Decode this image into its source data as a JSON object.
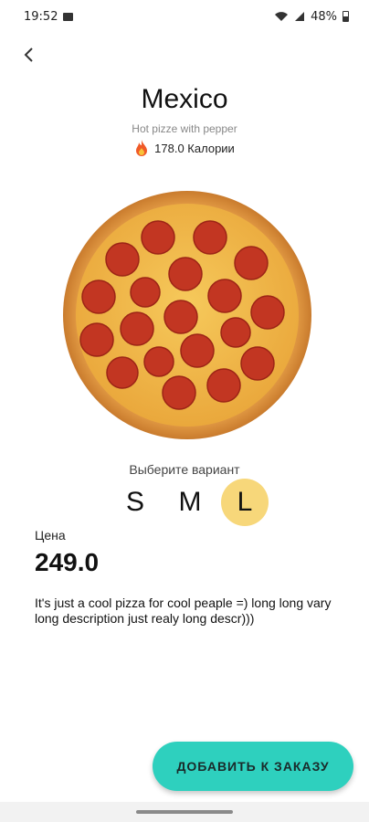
{
  "status_bar": {
    "time": "19:52",
    "battery": "48%",
    "icons": [
      "image-icon",
      "wifi-icon",
      "signal-icon",
      "battery-icon"
    ]
  },
  "product": {
    "name": "Mexico",
    "subtitle": "Hot pizze with pepper",
    "calories": "178.0 Калории",
    "calories_icon": "fire-icon"
  },
  "variants": {
    "label": "Выберите вариант",
    "options": [
      "S",
      "M",
      "L"
    ],
    "selected": "L"
  },
  "price": {
    "label": "Цена",
    "value": "249.0"
  },
  "description": "It's just a cool pizza for cool peaple =) long long  vary long description just realy long descr)))",
  "actions": {
    "add_to_order": "ДОБАВИТЬ К ЗАКАЗУ"
  },
  "colors": {
    "accent": "#2ed0be",
    "selected_size": "#f7d77a",
    "fire": "#f05a28"
  }
}
